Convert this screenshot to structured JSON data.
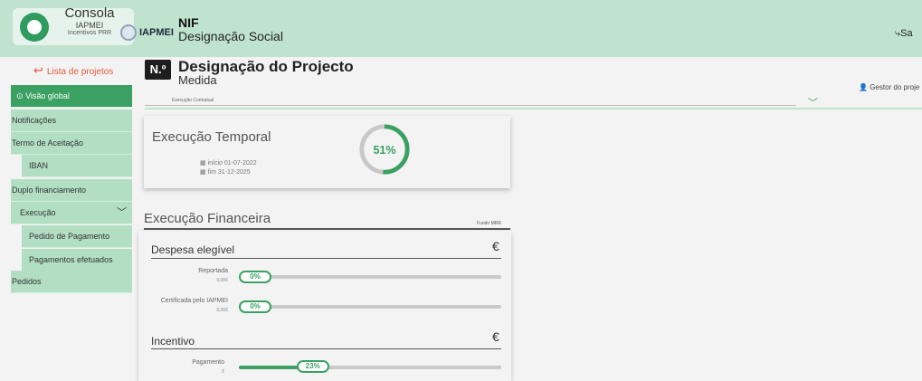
{
  "header": {
    "consola_title": "Consola",
    "consola_sub1": "IAPMEI",
    "consola_sub2": "Incentivos PRR",
    "iapmei": "IAPMEI",
    "nif": "NIF",
    "designacao": "Designação Social",
    "sair": "Sa"
  },
  "sidebar": {
    "lista": "Lista de projetos",
    "items": [
      {
        "label": "Visão global",
        "icon": "⊙"
      },
      {
        "label": "Notificações"
      },
      {
        "label": "Termo de Aceitação"
      },
      {
        "label": "IBAN"
      },
      {
        "label": "Duplo financiamento"
      },
      {
        "label": "Execução"
      },
      {
        "label": "Pedido de Pagamento"
      },
      {
        "label": "Pagamentos efetuados"
      },
      {
        "label": "Pedidos"
      }
    ]
  },
  "project": {
    "nbox": "N.º",
    "title": "Designação do Projecto",
    "medida": "Medida",
    "gestor": "Gestor do proje",
    "select_label": "Execução Contratual"
  },
  "temporal": {
    "title": "Execução Temporal",
    "inicio": "início  01-07-2022",
    "fim": "fim    31-12-2025",
    "percent_label": "51%",
    "percent": 0.51
  },
  "financeira": {
    "title": "Execução Financeira",
    "fundo": "Fundo MRR",
    "despesa": {
      "title": "Despesa elegível",
      "euro": "€",
      "rows": [
        {
          "label": "Reportada",
          "sub": "0,00€",
          "pct_label": "0%",
          "pct": 0
        },
        {
          "label": "Certificada pelo IAPMEI",
          "sub": "0,00€",
          "pct_label": "0%",
          "pct": 0
        }
      ]
    },
    "incentivo": {
      "title": "Incentivo",
      "euro": "€",
      "rows": [
        {
          "label": "Pagamento",
          "sub": "€",
          "pct_label": "23%",
          "pct": 0.23
        }
      ]
    }
  },
  "colors": {
    "accent": "#3aa163",
    "topbar": "#bfe3cf",
    "sidebar": "#b2dfc3",
    "link": "#e05a3a"
  }
}
